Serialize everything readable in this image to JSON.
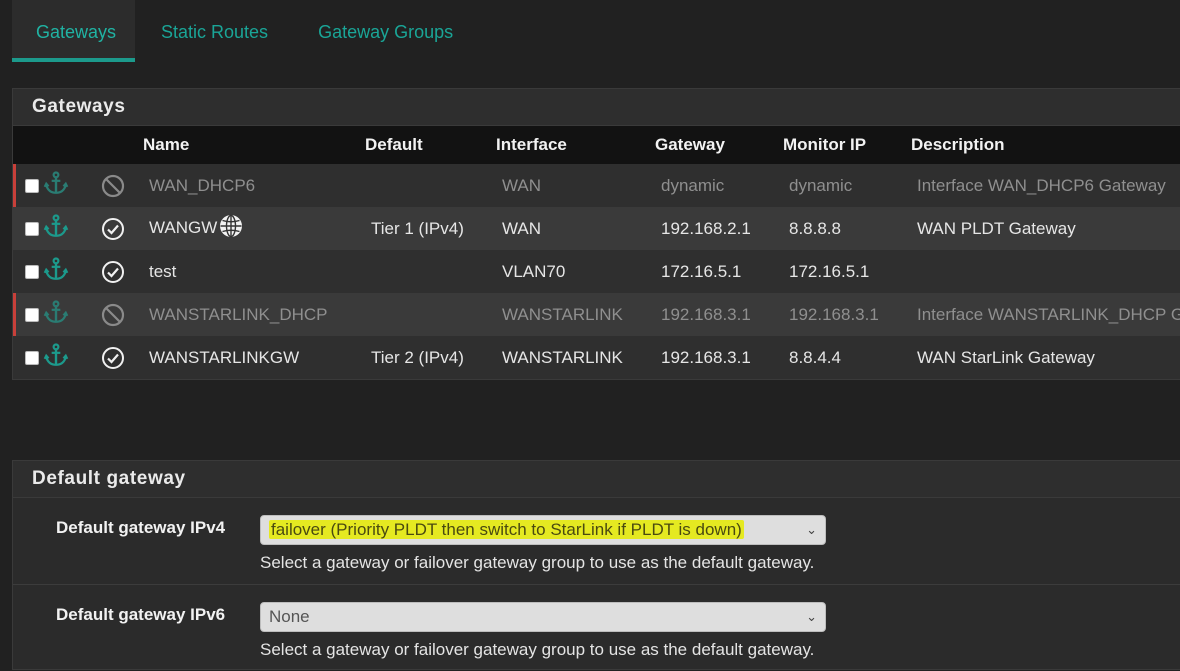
{
  "tabs": [
    {
      "label": "Gateways",
      "active": true
    },
    {
      "label": "Static Routes",
      "active": false
    },
    {
      "label": "Gateway Groups",
      "active": false
    }
  ],
  "gateways_panel": {
    "title": "Gateways",
    "columns": [
      "Name",
      "Default",
      "Interface",
      "Gateway",
      "Monitor IP",
      "Description"
    ],
    "rows": [
      {
        "status": "disabled",
        "name": "WAN_DHCP6",
        "globe": false,
        "default": "",
        "interface": "WAN",
        "gateway": "dynamic",
        "monitor": "dynamic",
        "description": "Interface WAN_DHCP6 Gateway"
      },
      {
        "status": "ok",
        "name": "WANGW",
        "globe": true,
        "default": "Tier 1 (IPv4)",
        "interface": "WAN",
        "gateway": "192.168.2.1",
        "monitor": "8.8.8.8",
        "description": "WAN PLDT Gateway"
      },
      {
        "status": "ok",
        "name": "test",
        "globe": false,
        "default": "",
        "interface": "VLAN70",
        "gateway": "172.16.5.1",
        "monitor": "172.16.5.1",
        "description": ""
      },
      {
        "status": "disabled",
        "name": "WANSTARLINK_DHCP",
        "globe": false,
        "default": "",
        "interface": "WANSTARLINK",
        "gateway": "192.168.3.1",
        "monitor": "192.168.3.1",
        "description": "Interface WANSTARLINK_DHCP Gateway"
      },
      {
        "status": "ok",
        "name": "WANSTARLINKGW",
        "globe": false,
        "default": "Tier 2 (IPv4)",
        "interface": "WANSTARLINK",
        "gateway": "192.168.3.1",
        "monitor": "8.8.4.4",
        "description": "WAN StarLink Gateway"
      }
    ]
  },
  "default_panel": {
    "title": "Default gateway",
    "ipv4": {
      "label": "Default gateway IPv4",
      "value": "failover (Priority PLDT then switch to StarLink if PLDT is down)",
      "help": "Select a gateway or failover gateway group to use as the default gateway."
    },
    "ipv6": {
      "label": "Default gateway IPv6",
      "value": "None",
      "help": "Select a gateway or failover gateway group to use as the default gateway."
    }
  },
  "colors": {
    "accent": "#1aa597",
    "disabled_marker": "#c8403a",
    "highlight": "#e6eb00"
  },
  "icons": {
    "anchor": "anchor-icon",
    "enabled": "check-circle-icon",
    "disabled": "ban-icon",
    "default_gateway": "globe-icon",
    "select": "chevron-down-icon"
  }
}
